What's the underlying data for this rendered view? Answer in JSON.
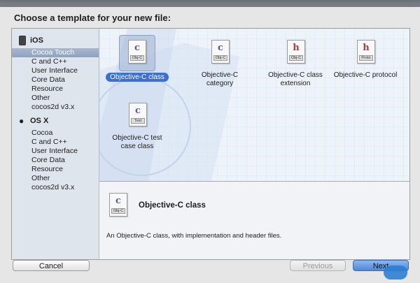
{
  "dialog": {
    "title": "Choose a template for your new file:"
  },
  "sidebar": {
    "groups": [
      {
        "name": "iOS",
        "items": [
          "Cocoa Touch",
          "C and C++",
          "User Interface",
          "Core Data",
          "Resource",
          "Other",
          "cocos2d v3.x"
        ]
      },
      {
        "name": "OS X",
        "items": [
          "Cocoa",
          "C and C++",
          "User Interface",
          "Core Data",
          "Resource",
          "Other",
          "cocos2d v3.x"
        ]
      }
    ],
    "selected_item": "Cocoa Touch"
  },
  "templates": [
    {
      "label": "Objective-C class",
      "icon_letter": "c",
      "icon_tag": "Obj-C",
      "selected": true
    },
    {
      "label": "Objective-C category",
      "icon_letter": "c",
      "icon_tag": "Obj-C",
      "selected": false
    },
    {
      "label": "Objective-C class extension",
      "icon_letter": "h",
      "icon_tag": "Obj-C",
      "selected": false
    },
    {
      "label": "Objective-C protocol",
      "icon_letter": "h",
      "icon_tag": "Proto",
      "selected": false
    },
    {
      "label": "Objective-C test case class",
      "icon_letter": "c",
      "icon_tag": "Test",
      "selected": false
    }
  ],
  "detail": {
    "title": "Objective-C class",
    "icon_tag": "Obj-C",
    "description": "An Objective-C class, with implementation and header files."
  },
  "buttons": {
    "cancel": "Cancel",
    "previous": "Previous",
    "next": "Next"
  },
  "colors": {
    "selection": "#3c70d0",
    "sidebar_selected": "#8ea2bf",
    "letter_c": "#5b5b9a",
    "letter_h": "#b33a3a"
  },
  "watermark": "iThome"
}
